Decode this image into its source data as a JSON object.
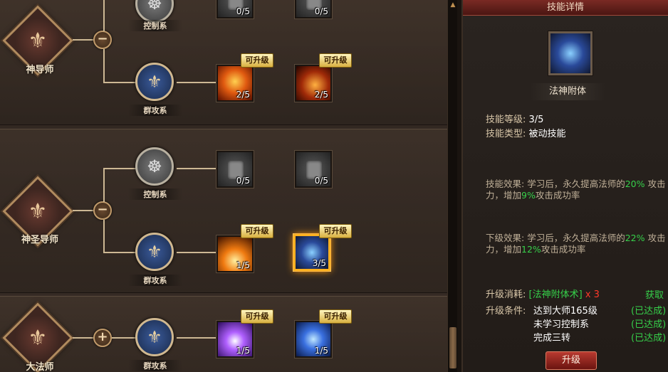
{
  "classes": [
    {
      "name": "神导师",
      "toggle": "−"
    },
    {
      "name": "神圣导师",
      "toggle": "−"
    },
    {
      "name": "大法师",
      "toggle": "+"
    }
  ],
  "branches": {
    "control": "控制系",
    "aoe": "群攻系"
  },
  "skills": {
    "s0a": "0/5",
    "s0b": "0/5",
    "s1a": "2/5",
    "s1b": "2/5",
    "s2a": "0/5",
    "s2b": "0/5",
    "s3a": "1/5",
    "s3b": "3/5",
    "s4a": "1/5",
    "s4b": "1/5"
  },
  "badge": "可升级",
  "detail": {
    "title": "技能详情",
    "skill_name": "法神附体",
    "level_label": "技能等级:",
    "level_value": "3/5",
    "type_label": "技能类型:",
    "type_value": "被动技能",
    "effect_label": "技能效果:",
    "effect_text_1": "学习后，永久提高法师的",
    "effect_pct": "20%",
    "effect_text_2": "攻击力，增加",
    "effect_pct2": "9%",
    "effect_text_3": "攻击成功率",
    "next_label": "下级效果:",
    "next_text_1": "学习后，永久提高法师的",
    "next_pct": "22%",
    "next_text_2": "攻击力，增加",
    "next_pct2": "12%",
    "next_text_3": "攻击成功率",
    "cost_label": "升级消耗:",
    "cost_item": "[法神附体术]",
    "cost_qty": "x 3",
    "obtain": "获取",
    "cond_label": "升级条件:",
    "cond1": "达到大师165级",
    "cond2": "未学习控制系",
    "cond3": "完成三转",
    "cond_status": "(已达成)",
    "upgrade_btn": "升级"
  },
  "colors": {
    "accent_green": "#36d04a",
    "accent_red": "#ff3a2a",
    "badge_gold": "#d8b040"
  }
}
